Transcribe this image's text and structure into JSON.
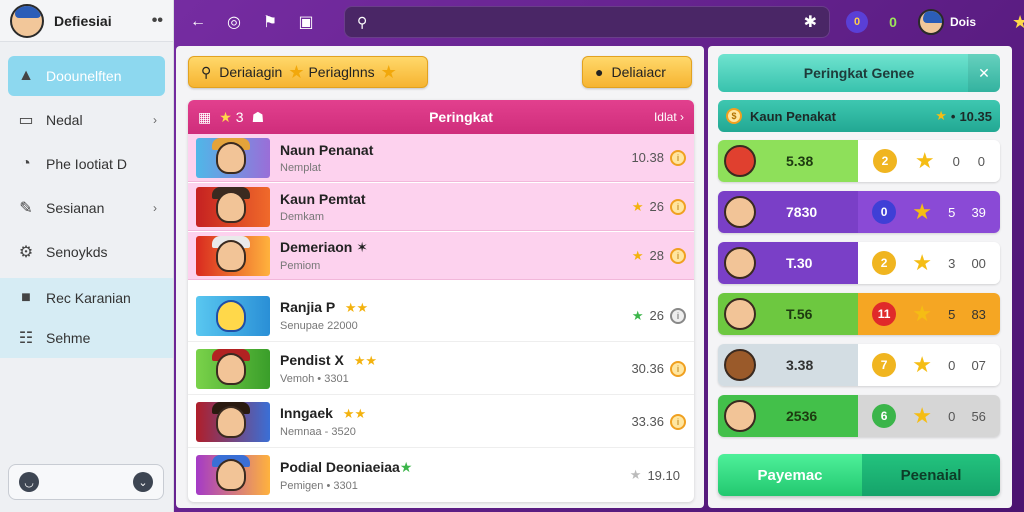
{
  "sidebar": {
    "title": "Defiesiai",
    "items": [
      {
        "label": "Doounelften"
      },
      {
        "label": "Nedal"
      },
      {
        "label": "Phe Iootiat D"
      },
      {
        "label": "Sesianan"
      },
      {
        "label": "Senoykds"
      },
      {
        "label": "Rec Karanian"
      },
      {
        "label": "Sehme"
      }
    ]
  },
  "topbar": {
    "search_placeholder": "",
    "notif_count": "0",
    "green_count": "0",
    "user_name": "Dois"
  },
  "main": {
    "btn_left": "Deriaiagin",
    "btn_left_2": "Periaglnns",
    "btn_right": "Deliaiacr",
    "ranking_title": "Peringkat",
    "ranking_left_count": "3",
    "ranking_right": "Idlat",
    "rows": [
      {
        "name": "Naun Penanat",
        "sub": "Nemplat",
        "value": "10.38"
      },
      {
        "name": "Kaun Pemtat",
        "sub": "Demkam",
        "value": "26"
      },
      {
        "name": "Demeriaon",
        "sub": "Pemiom",
        "value": "28"
      },
      {
        "name": "Ranjia P",
        "sub": "Senupae 22000",
        "value": "26"
      },
      {
        "name": "Pendist X",
        "sub": "Vemoh • 3301",
        "value": "30.36"
      },
      {
        "name": "Inngaek",
        "sub": "Nemnaa - 3520",
        "value": "33.36"
      },
      {
        "name": "Podial Deoniaeiaa",
        "sub": "Pemigen • 3301",
        "value": "19.10"
      }
    ]
  },
  "right": {
    "title": "Peringkat Genee",
    "sub_label": "Kaun Penakat",
    "sub_value": "10.35",
    "rows": [
      {
        "score": "5.38",
        "badge": "2",
        "a": "0",
        "b": "0",
        "color": "#7ddc55"
      },
      {
        "score": "7830",
        "badge": "0",
        "a": "5",
        "b": "39",
        "color": "#7a3fc7"
      },
      {
        "score": "T.30",
        "badge": "2",
        "a": "3",
        "b": "00",
        "color": "#7a3fc7"
      },
      {
        "score": "T.56",
        "badge": "11",
        "a": "5",
        "b": "83",
        "color": "#6dc840"
      },
      {
        "score": "3.38",
        "badge": "7",
        "a": "0",
        "b": "07",
        "color": "#d3dde3"
      },
      {
        "score": "2536",
        "badge": "6",
        "a": "0",
        "b": "56",
        "color": "#43c04a"
      }
    ],
    "footer_left": "Payemac",
    "footer_right": "Peenaial"
  }
}
